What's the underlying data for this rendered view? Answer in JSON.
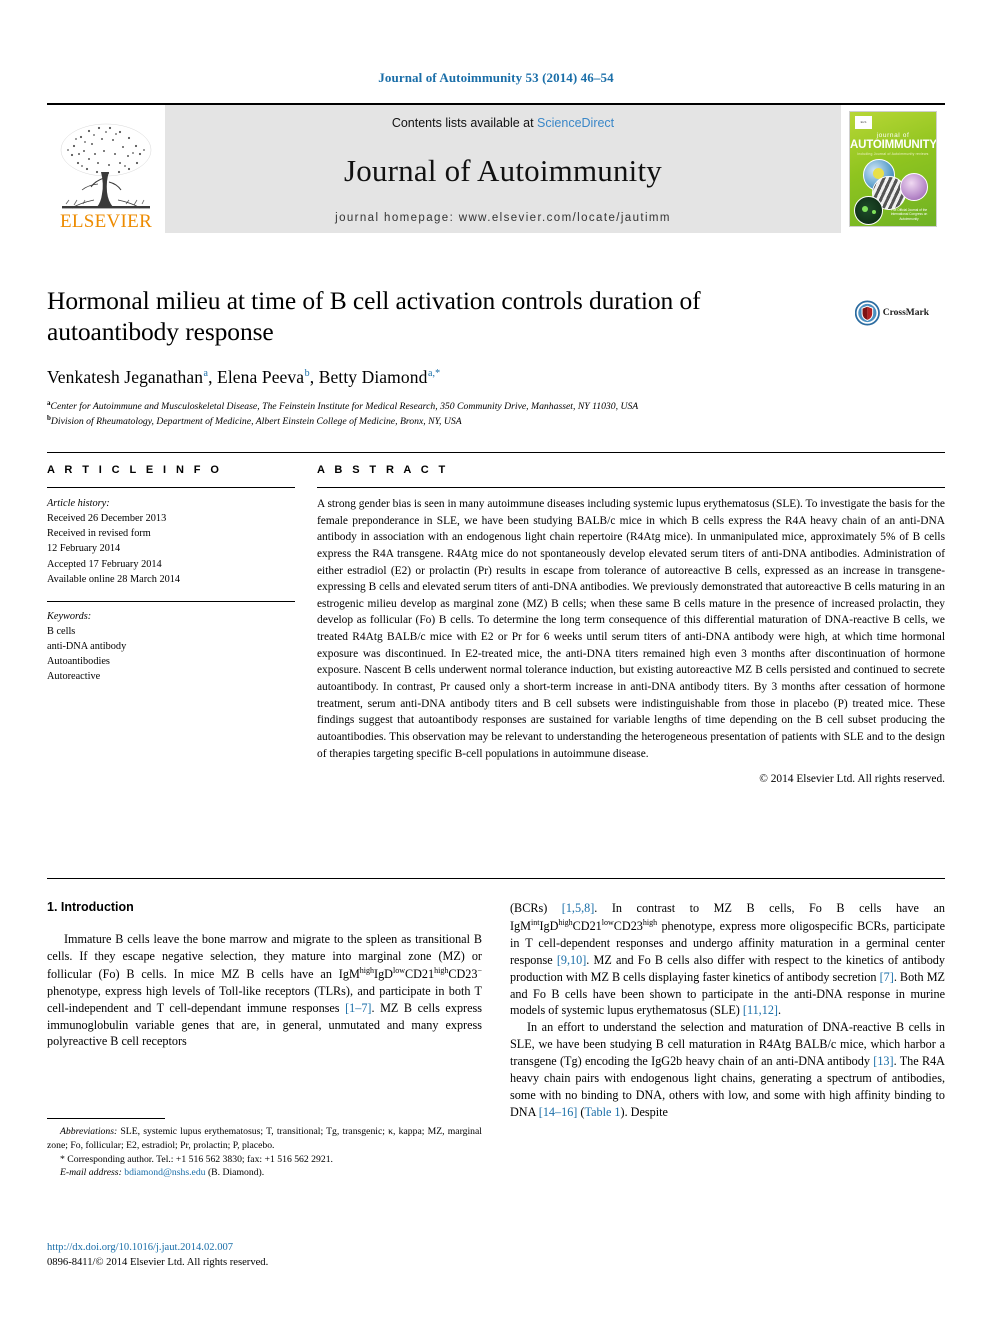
{
  "running_head": "Journal of Autoimmunity 53 (2014) 46–54",
  "masthead": {
    "publisher_name": "ELSEVIER",
    "contents_prefix": "Contents lists available at ",
    "contents_link": "ScienceDirect",
    "journal_title": "Journal of Autoimmunity",
    "homepage": "journal homepage: www.elsevier.com/locate/jautimm",
    "cover": {
      "publisher_mark": "ELSEVIER",
      "line1": "journal of",
      "line2": "AUTOIMMUNITY",
      "subtitle": "including Journal of Autoimmunity reviews",
      "footer": "The Official Journal of\nthe International Congress\non Autoimmunity"
    }
  },
  "crossmark": {
    "label": "CrossMark"
  },
  "title": "Hormonal milieu at time of B cell activation controls duration of autoantibody response",
  "authors": [
    {
      "name": "Venkatesh Jeganathan",
      "marks": "a"
    },
    {
      "name": "Elena Peeva",
      "marks": "b"
    },
    {
      "name": "Betty Diamond",
      "marks": "a,*"
    }
  ],
  "authors_line_sep": ", ",
  "affiliations": [
    {
      "mark": "a",
      "text": "Center for Autoimmune and Musculoskeletal Disease, The Feinstein Institute for Medical Research, 350 Community Drive, Manhasset, NY 11030, USA"
    },
    {
      "mark": "b",
      "text": "Division of Rheumatology, Department of Medicine, Albert Einstein College of Medicine, Bronx, NY, USA"
    }
  ],
  "article_info": {
    "heading": "A R T I C L E   I N F O",
    "history_label": "Article history:",
    "history": [
      "Received 26 December 2013",
      "Received in revised form",
      "12 February 2014",
      "Accepted 17 February 2014",
      "Available online 28 March 2014"
    ],
    "keywords_label": "Keywords:",
    "keywords": [
      "B cells",
      "anti-DNA antibody",
      "Autoantibodies",
      "Autoreactive"
    ]
  },
  "abstract": {
    "heading": "A B S T R A C T",
    "text": "A strong gender bias is seen in many autoimmune diseases including systemic lupus erythematosus (SLE). To investigate the basis for the female preponderance in SLE, we have been studying BALB/c mice in which B cells express the R4A heavy chain of an anti-DNA antibody in association with an endogenous light chain repertoire (R4Atg mice). In unmanipulated mice, approximately 5% of B cells express the R4A transgene. R4Atg mice do not spontaneously develop elevated serum titers of anti-DNA antibodies. Administration of either estradiol (E2) or prolactin (Pr) results in escape from tolerance of autoreactive B cells, expressed as an increase in transgene-expressing B cells and elevated serum titers of anti-DNA antibodies. We previously demonstrated that autoreactive B cells maturing in an estrogenic milieu develop as marginal zone (MZ) B cells; when these same B cells mature in the presence of increased prolactin, they develop as follicular (Fo) B cells. To determine the long term consequence of this differential maturation of DNA-reactive B cells, we treated R4Atg BALB/c mice with E2 or Pr for 6 weeks until serum titers of anti-DNA antibody were high, at which time hormonal exposure was discontinued. In E2-treated mice, the anti-DNA titers remained high even 3 months after discontinuation of hormone exposure. Nascent B cells underwent normal tolerance induction, but existing autoreactive MZ B cells persisted and continued to secrete autoantibody. In contrast, Pr caused only a short-term increase in anti-DNA antibody titers. By 3 months after cessation of hormone treatment, serum anti-DNA antibody titers and B cell subsets were indistinguishable from those in placebo (P) treated mice. These findings suggest that autoantibody responses are sustained for variable lengths of time depending on the B cell subset producing the autoantibodies. This observation may be relevant to understanding the heterogeneous presentation of patients with SLE and to the design of therapies targeting specific B-cell populations in autoimmune disease.",
    "copyright": "© 2014 Elsevier Ltd. All rights reserved."
  },
  "section": {
    "number_title": "1. Introduction"
  },
  "body": {
    "left_p1_a": "Immature B cells leave the bone marrow and migrate to the spleen as transitional B cells. If they escape negative selection, they mature into marginal zone (MZ) or follicular (Fo) B cells. In mice MZ B cells have an IgM",
    "left_sup1": "high",
    "left_p1_b": "IgD",
    "left_sup2": "low",
    "left_p1_c": "CD21",
    "left_sup3": "high",
    "left_p1_d": "CD23",
    "left_sup4": "−",
    "left_p1_e": " phenotype, express high levels of Toll-like receptors (TLRs), and participate in both T cell-independent and T cell-dependant immune responses ",
    "left_ref1": "[1–7]",
    "left_p1_f": ". MZ B cells express immunoglobulin variable genes that are, in general, unmutated and many express polyreactive B cell receptors",
    "right_p1_a": "(BCRs) ",
    "right_ref1": "[1,5,8]",
    "right_p1_b": ". In contrast to MZ B cells, Fo B cells have an IgM",
    "right_sup1": "int",
    "right_p1_c": "IgD",
    "right_sup2": "high",
    "right_p1_d": "CD21",
    "right_sup3": "low",
    "right_p1_e": "CD23",
    "right_sup4": "high",
    "right_p1_f": " phenotype, express more oligospecific BCRs, participate in T cell-dependent responses and undergo affinity maturation in a germinal center response ",
    "right_ref2": "[9,10]",
    "right_p1_g": ". MZ and Fo B cells also differ with respect to the kinetics of antibody production with MZ B cells displaying faster kinetics of antibody secretion ",
    "right_ref3": "[7]",
    "right_p1_h": ". Both MZ and Fo B cells have been shown to participate in the anti-DNA response in murine models of systemic lupus erythematosus (SLE) ",
    "right_ref4": "[11,12]",
    "right_p1_i": ".",
    "right_p2_a": "In an effort to understand the selection and maturation of DNA-reactive B cells in SLE, we have been studying B cell maturation in R4Atg BALB/c mice, which harbor a transgene (Tg) encoding the IgG2b heavy chain of an anti-DNA antibody ",
    "right_ref5": "[13]",
    "right_p2_b": ". The R4A heavy chain pairs with endogenous light chains, generating a spectrum of antibodies, some with no binding to DNA, others with low, and some with high affinity binding to DNA ",
    "right_ref6": "[14–16]",
    "right_p2_c": " (",
    "right_ref7": "Table 1",
    "right_p2_d": "). Despite"
  },
  "footnotes": {
    "abbrev_label": "Abbreviations:",
    "abbrev_text": " SLE, systemic lupus erythematosus; T, transitional; Tg, transgenic; κ, kappa; MZ, marginal zone; Fo, follicular; E2, estradiol; Pr, prolactin; P, placebo.",
    "corresponding": "* Corresponding author. Tel.: +1 516 562 3830; fax: +1 516 562 2921.",
    "email_label": "E-mail address:",
    "email": "bdiamond@nshs.edu",
    "email_suffix": " (B. Diamond)."
  },
  "imprint": {
    "doi": "http://dx.doi.org/10.1016/j.jaut.2014.02.007",
    "issn_line": "0896-8411/© 2014 Elsevier Ltd. All rights reserved."
  },
  "colors": {
    "link_blue": "#1a6ea8",
    "elsevier_orange": "#ED8B00",
    "masthead_grey": "#e4e4e4"
  }
}
